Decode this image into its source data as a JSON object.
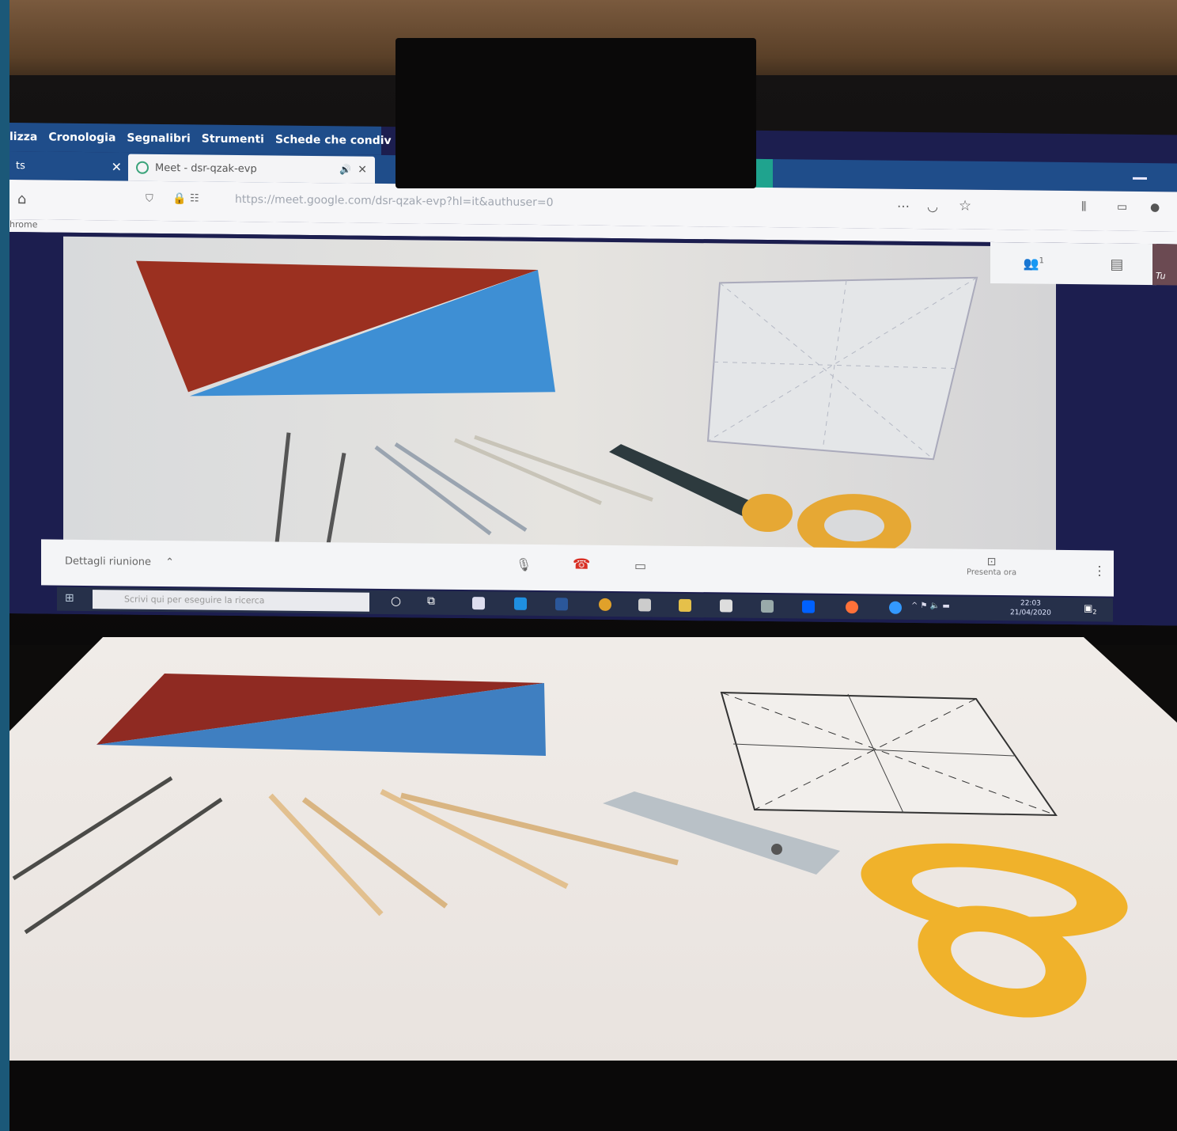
{
  "browser": {
    "menu": [
      "lizza",
      "Cronologia",
      "Segnalibri",
      "Strumenti",
      "Schede che condiv"
    ],
    "prev_tab_label": "ts",
    "active_tab_title": "Meet - dsr-qzak-evp",
    "url": "https://meet.google.com/dsr-qzak-evp?hl=it&authuser=0",
    "bookmarks_fragment": "hrome"
  },
  "meet": {
    "participants_count": "1",
    "self_label": "Tu",
    "meeting_details_label": "Dettagli riunione",
    "present_label": "Presenta ora"
  },
  "taskbar": {
    "search_placeholder": "Scrivi qui per eseguire la ricerca",
    "time": "22:03",
    "date": "21/04/2020",
    "notification_count": "2"
  },
  "colors": {
    "red_paper": "#8f2a22",
    "blue_paper": "#3f7fc1",
    "scissors_handle": "#f0b22b",
    "border": "#1b5878"
  }
}
